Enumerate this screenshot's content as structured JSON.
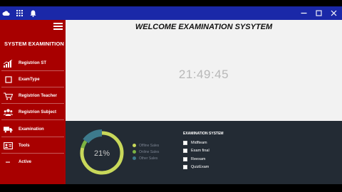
{
  "colors": {
    "titlebar": "#1a28a8",
    "sidebar": "#a80000",
    "main_bg": "#f2f2f2",
    "bottom_panel": "#232b34",
    "donut_track": "#c8d85a",
    "donut_green": "#7cb342",
    "donut_teal": "#3d7a8c"
  },
  "titlebar": {
    "left_icons": [
      "cloud-icon",
      "grid-icon",
      "bell-icon"
    ],
    "controls": [
      "minimize-icon",
      "maximize-icon",
      "close-icon"
    ]
  },
  "sidebar": {
    "title": "SYSTEM EXAMINITION",
    "items": [
      {
        "label": "Registrion ST",
        "icon": "bar-chart-icon"
      },
      {
        "label": "ExamType",
        "icon": "square-icon"
      },
      {
        "label": "Registrion Teacher",
        "icon": "cart-icon"
      },
      {
        "label": "Registrion Subject",
        "icon": "users-icon"
      },
      {
        "label": "Examination",
        "icon": "truck-icon"
      },
      {
        "label": "Tools",
        "icon": "id-card-icon"
      },
      {
        "label": "Active",
        "icon": "dash-icon"
      }
    ]
  },
  "main": {
    "title": "WELCOME EXAMINATION SYSYTEM",
    "clock": "21:49:45"
  },
  "donut": {
    "center_label": "21%",
    "segments": [
      {
        "label": "Offline Sales",
        "value": 0.79,
        "color": "#c8d85a"
      },
      {
        "label": "Online Sales",
        "value": 0.06,
        "color": "#7cb342"
      },
      {
        "label": "Other Sales",
        "value": 0.15,
        "color": "#3d7a8c"
      }
    ]
  },
  "exam_system": {
    "title": "EXAMINATION SYSTEM",
    "options": [
      "Midfteam",
      "Exam final",
      "Reexam",
      "QuizExam"
    ]
  }
}
